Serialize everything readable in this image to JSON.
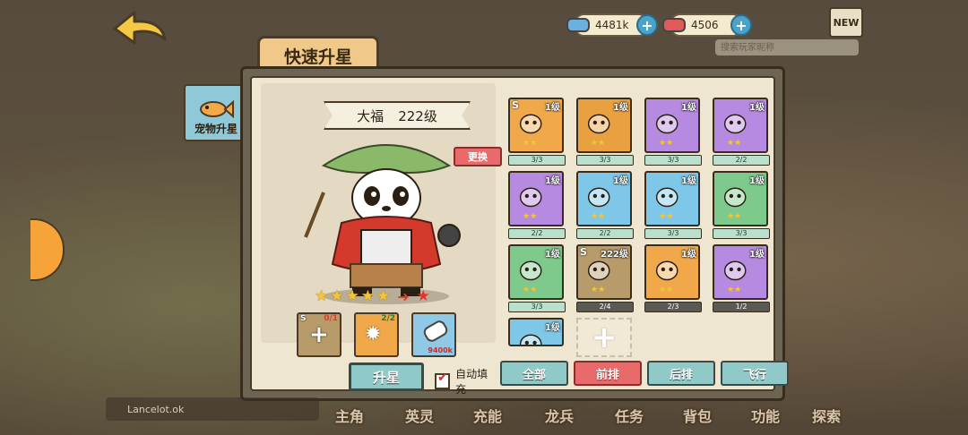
{
  "top": {
    "resources": [
      {
        "id": "energy",
        "value": "4481k",
        "color": "#6ab0e0"
      },
      {
        "id": "gems",
        "value": "4506",
        "color": "#e05a5a"
      }
    ],
    "new_badge": "NEW",
    "search_placeholder": "搜索玩家昵称"
  },
  "sidebar": {
    "pet_upgrade_label": "宠物升星"
  },
  "dialog": {
    "title": "快速升星",
    "pet": {
      "name": "大福",
      "level": "222级",
      "stars_from": 5,
      "stars_to": 1
    },
    "change_button": "更换",
    "materials": [
      {
        "count": "0/1",
        "color": "#b89b6a"
      },
      {
        "count": "2/2",
        "color": "#f0a84a"
      },
      {
        "count": "9400k",
        "color": "#8fc9e6"
      }
    ],
    "upgrade_button": "升星",
    "auto_fill_label": "自动填充",
    "auto_fill_checked": true,
    "pets_grid": [
      {
        "level": "1级",
        "progress": "3/3",
        "color": "#f0a84a",
        "s": "S"
      },
      {
        "level": "1级",
        "progress": "3/3",
        "color": "#e8a040"
      },
      {
        "level": "1级",
        "progress": "3/3",
        "color": "#b68ae0"
      },
      {
        "level": "1级",
        "progress": "2/2",
        "color": "#b68ae0"
      },
      {
        "level": "1级",
        "progress": "2/2",
        "color": "#b68ae0"
      },
      {
        "level": "1级",
        "progress": "2/2",
        "color": "#7fc7e8"
      },
      {
        "level": "1级",
        "progress": "3/3",
        "color": "#7fc7e8"
      },
      {
        "level": "1级",
        "progress": "3/3",
        "color": "#7ec98c"
      },
      {
        "level": "1级",
        "progress": "3/3",
        "color": "#7ec98c"
      },
      {
        "level": "222级",
        "progress": "2/4",
        "color": "#b89b6a",
        "s": "S",
        "dark": true
      },
      {
        "level": "1级",
        "progress": "2/3",
        "color": "#f0a84a",
        "dark": true
      },
      {
        "level": "1级",
        "progress": "1/2",
        "color": "#b68ae0",
        "dark": true
      },
      {
        "level": "1级",
        "progress": "",
        "color": "#7fc7e8"
      }
    ],
    "filters": [
      {
        "label": "全部",
        "active": false
      },
      {
        "label": "前排",
        "active": true
      },
      {
        "label": "后排",
        "active": false
      },
      {
        "label": "飞行",
        "active": false
      }
    ]
  },
  "bottom": {
    "player_tag": "",
    "player_name": "Lancelot.ok",
    "nav": [
      "主角",
      "英灵",
      "充能",
      "龙兵",
      "任务",
      "背包",
      "功能",
      "探索"
    ]
  }
}
